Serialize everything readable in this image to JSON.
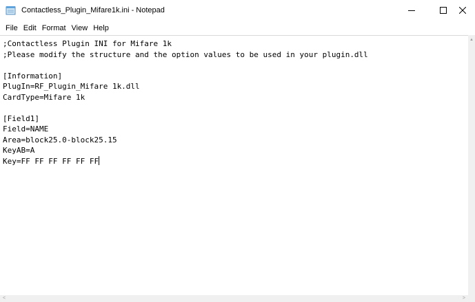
{
  "window": {
    "title": "Contactless_Plugin_Mifare1k.ini - Notepad",
    "icon": "notepad-icon",
    "controls": {
      "minimize": "minimize-icon",
      "maximize": "maximize-icon",
      "close": "close-icon"
    }
  },
  "menu": {
    "items": [
      {
        "label": "File"
      },
      {
        "label": "Edit"
      },
      {
        "label": "Format"
      },
      {
        "label": "View"
      },
      {
        "label": "Help"
      }
    ]
  },
  "editor": {
    "lines": [
      ";Contactless Plugin INI for Mifare 1k",
      ";Please modify the structure and the option values to be used in your plugin.dll",
      "",
      "[Information]",
      "PlugIn=RF_Plugin_Mifare 1k.dll",
      "CardType=Mifare 1k",
      "",
      "[Field1]",
      "Field=NAME",
      "Area=block25.0-block25.15",
      "KeyAB=A",
      "Key=FF FF FF FF FF FF"
    ]
  },
  "colors": {
    "background": "#ffffff",
    "text": "#000000",
    "scrollbar": "#f0f0f0"
  }
}
